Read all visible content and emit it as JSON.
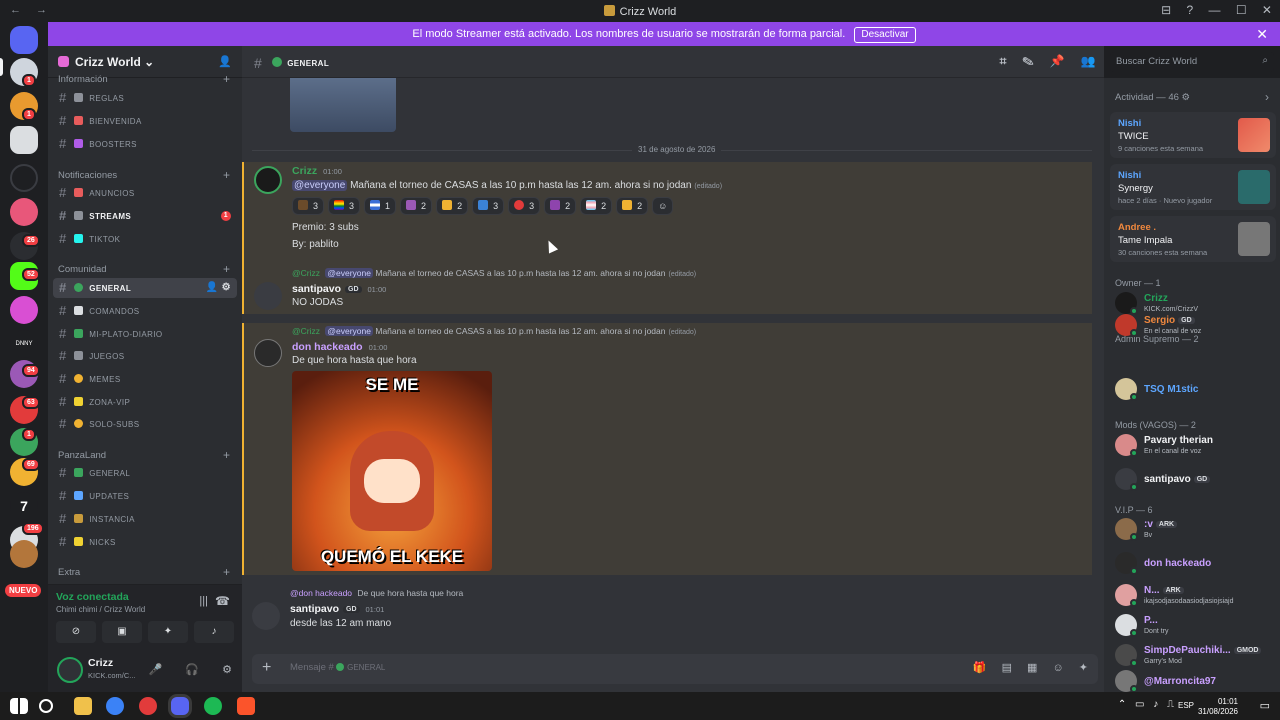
{
  "window": {
    "title": "Crizz World",
    "controls": "⊟ ? — ☐ ✕"
  },
  "banner": {
    "text": "El modo Streamer está activado. Los nombres de usuario se mostrarán de forma parcial.",
    "button": "Desactivar"
  },
  "server": {
    "name": "Crizz World"
  },
  "guild_badges": [
    "1",
    "1",
    "26",
    "52",
    "94",
    "63",
    "1",
    "69",
    "196"
  ],
  "nuevo": "NUEVO",
  "categories": {
    "info": "Información",
    "notif": "Notificaciones",
    "comunidad": "Comunidad",
    "panza": "PanzaLand",
    "extra": "Extra"
  },
  "channels": {
    "reglas": "REGLAS",
    "bienvenida": "BIENVENIDA",
    "boosters": "BOOSTERS",
    "anuncios": "ANUNCIOS",
    "streams": "STREAMS",
    "streams_badge": "1",
    "tiktok": "TIKTOK",
    "general": "GENERAL",
    "comandos": "COMANDOS",
    "miplato": "MI-PLATO-DIARIO",
    "juegos": "JUEGOS",
    "memes": "MEMES",
    "zonavip": "ZONA-VIP",
    "solosubs": "SOLO-SUBS",
    "pl_general": "GENERAL",
    "updates": "UPDATES",
    "instancia": "INSTANCIA",
    "nicks": "NICKS"
  },
  "voice": {
    "status": "Voz conectada",
    "channel": "Chimi chimi / Crizz World"
  },
  "user": {
    "name": "Crizz",
    "status": "KICK.com/C..."
  },
  "header": {
    "channel": "GENERAL"
  },
  "search": {
    "placeholder": "Buscar Crizz World"
  },
  "date_divider": "31 de agosto de 2026",
  "messages": [
    {
      "author": "Crizz",
      "time": "01:00",
      "mention": "@everyone",
      "text": "Mañana el torneo de CASAS a las 10 p.m hasta las 12 am. ahora si no jodan",
      "edited": "(editado)",
      "line2": "Premio: 3 subs",
      "line3": "By: pablito"
    },
    {
      "reply_to": "@Crizz",
      "reply_mention": "@everyone",
      "reply_text": "Mañana el torneo de CASAS a las 10 p.m hasta las 12 am. ahora si no jodan",
      "reply_edited": "(editado)",
      "author": "santipavo",
      "tag": "GD",
      "time": "01:00",
      "text": "NO JODAS"
    },
    {
      "reply_to": "@Crizz",
      "reply_mention": "@everyone",
      "reply_text": "Mañana el torneo de CASAS a las 10 p.m hasta las 12 am. ahora si no jodan",
      "reply_edited": "(editado)",
      "author": "don hackeado",
      "time": "01:00",
      "text": "De que hora hasta que hora",
      "gif_top": "SE ME",
      "gif_bottom": "QUEMÓ EL KEKE"
    },
    {
      "reply_to": "@don hackeado",
      "reply_text": "De que hora hasta que hora",
      "author": "santipavo",
      "tag": "GD",
      "time": "01:01",
      "text": "desde las 12 am mano"
    }
  ],
  "reactions": [
    "3",
    "3",
    "1",
    "2",
    "2",
    "3",
    "3",
    "2",
    "2",
    "2"
  ],
  "input": {
    "placeholder": "Mensaje #",
    "channel": "GENERAL"
  },
  "members": {
    "activity_label": "Actividad — 46",
    "cards": [
      {
        "name": "Nishi",
        "title": "TWICE",
        "sub": "9 canciones esta semana"
      },
      {
        "name": "Nishi",
        "title": "Synergy",
        "sub": "hace 2 días · Nuevo jugador"
      },
      {
        "name": "Andree .",
        "title": "Tame Impala",
        "sub": "30 canciones esta semana"
      }
    ],
    "owner_label": "Owner — 1",
    "admin_label": "Admin Supremo — 2",
    "mods_label": "Mods (VAGOS) — 2",
    "vip_label": "V.I.P — 6",
    "list": [
      {
        "name": "Crizz",
        "sub": "KICK.com/CrizzV",
        "color": "#23a55a"
      },
      {
        "name": "Sergio",
        "tag": "GD",
        "sub": "En el canal de voz",
        "color": "#f0883e"
      },
      {
        "name": "TSQ M1stic",
        "sub": "",
        "color": "#5da6ff"
      },
      {
        "name": "Pavary therian",
        "sub": "En el canal de voz",
        "color": "#f2f3f5"
      },
      {
        "name": "santipavo",
        "tag": "GD",
        "sub": "",
        "color": "#f2f3f5"
      },
      {
        "name": ":v",
        "tag": "ARK",
        "sub": "Bv",
        "color": "#c9a0ff"
      },
      {
        "name": "don hackeado",
        "sub": "",
        "color": "#c9a0ff"
      },
      {
        "name": "N...",
        "tag": "ARK",
        "sub": "ikajsodjasodaasiodjasiojsiajd",
        "color": "#c9a0ff"
      },
      {
        "name": "P...",
        "sub": "Dont try",
        "color": "#c9a0ff"
      },
      {
        "name": "SimpDePauchiki...",
        "tag": "GMOD",
        "sub": "Garry's Mod",
        "color": "#c9a0ff"
      },
      {
        "name": "@Marroncita97",
        "sub": "",
        "color": "#c9a0ff"
      }
    ]
  },
  "taskbar": {
    "lang": "ESP",
    "time": "01:01",
    "date": "31/08/2026"
  }
}
